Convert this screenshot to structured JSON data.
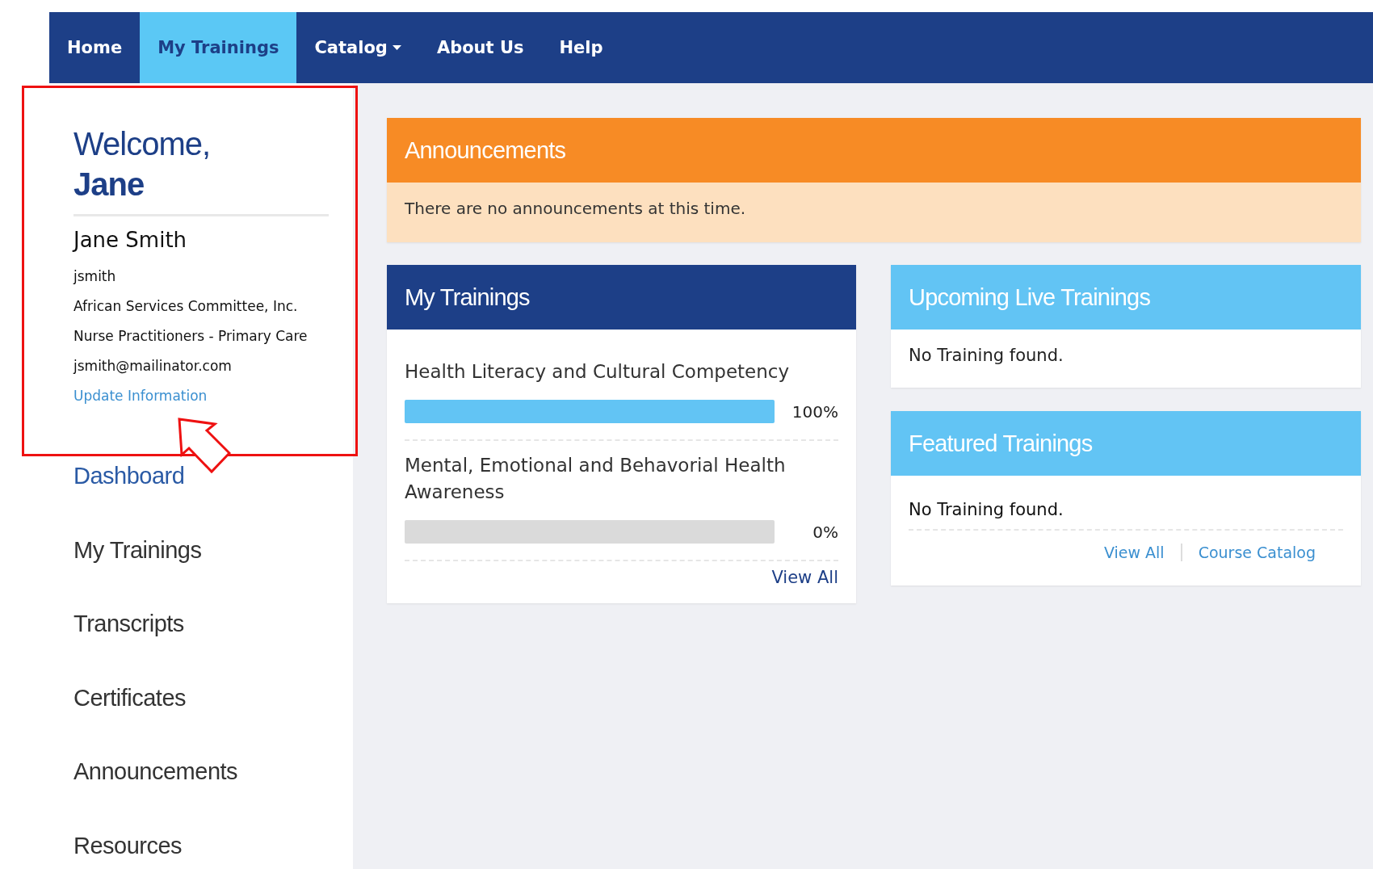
{
  "nav": {
    "items": [
      {
        "label": "Home",
        "selected": false,
        "kind": "link"
      },
      {
        "label": "My Trainings",
        "selected": true,
        "kind": "link"
      },
      {
        "label": "Catalog",
        "selected": false,
        "kind": "dropdown"
      },
      {
        "label": "About Us",
        "selected": false,
        "kind": "link"
      },
      {
        "label": "Help",
        "selected": false,
        "kind": "link"
      }
    ]
  },
  "profile": {
    "greeting": "Welcome,",
    "first_name": "Jane",
    "full_name": "Jane Smith",
    "details": [
      "jsmith",
      "African Services Committee, Inc.",
      "Nurse Practitioners - Primary Care",
      "jsmith@mailinator.com"
    ],
    "update_link": "Update Information"
  },
  "sidebar": {
    "items": [
      "Dashboard",
      "My Trainings",
      "Transcripts",
      "Certificates",
      "Announcements",
      "Resources"
    ]
  },
  "announcements": {
    "title": "Announcements",
    "message": "There are no announcements at this time."
  },
  "my_trainings": {
    "title": "My Trainings",
    "items": [
      {
        "title": "Health Literacy and Cultural Competency",
        "level": 1,
        "reading": "100%"
      },
      {
        "title": "Mental, Emotional and Behavorial Health Awareness",
        "level": 0,
        "reading": "0%"
      }
    ],
    "view_all": "View All"
  },
  "upcoming_live_trainings": {
    "title": "Upcoming Live Trainings",
    "message": "No Training found."
  },
  "featured_trainings": {
    "title": "Featured Trainings",
    "message": "No Training found.",
    "links": [
      "View All",
      "Course Catalog"
    ]
  }
}
